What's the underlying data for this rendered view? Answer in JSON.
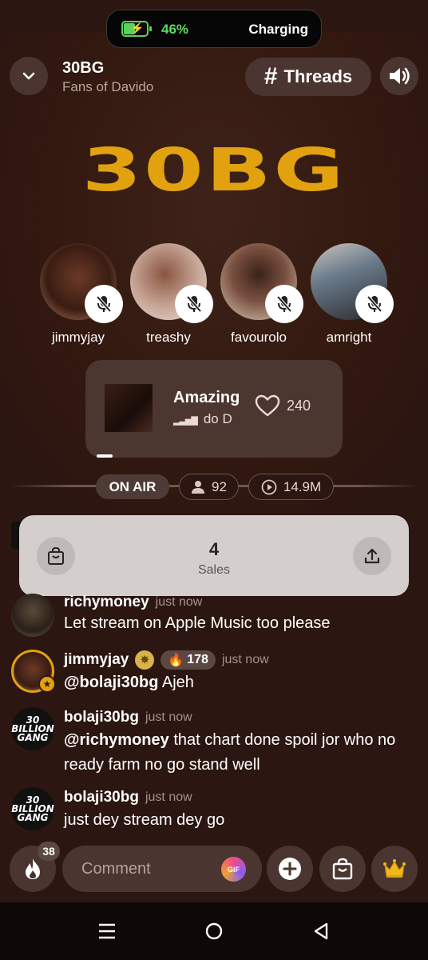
{
  "status": {
    "battery_percent": 46,
    "battery_text": "46%",
    "charging_text": "Charging"
  },
  "header": {
    "title": "30BG",
    "subtitle": "Fans of Davido",
    "threads_label": "Threads"
  },
  "logo_text": "30BG",
  "speakers": [
    {
      "name": "jimmyjay"
    },
    {
      "name": "treashy"
    },
    {
      "name": "favourolo"
    },
    {
      "name": "amright"
    }
  ],
  "now_playing": {
    "title": "Amazing",
    "subtitle": "do   D",
    "likes": "240"
  },
  "live": {
    "on_air_label": "ON AIR",
    "listeners": "92",
    "plays": "14.9M"
  },
  "sales": {
    "count": "4",
    "label": "Sales"
  },
  "messages": [
    {
      "user": "richymoney",
      "time": "just now",
      "mention": "",
      "text": "Let stream on Apple Music too please"
    },
    {
      "user": "jimmyjay",
      "time": "just now",
      "fire": "178",
      "mention": "@bolaji30bg",
      "text": "Ajeh"
    },
    {
      "user": "bolaji30bg",
      "time": "just now",
      "mention": "@richymoney",
      "text": "that chart done spoil jor who no ready farm no go stand well"
    },
    {
      "user": "bolaji30bg",
      "time": "just now",
      "mention": "",
      "text": "just dey stream dey go"
    }
  ],
  "gang_logo": "30 BILLION GANG",
  "composer": {
    "placeholder": "Comment",
    "gif_label": "GIF",
    "fire_count": "38"
  },
  "colors": {
    "background": "#2c1611",
    "accent_gold": "#e2a10e",
    "battery_green": "#5fdc62"
  }
}
